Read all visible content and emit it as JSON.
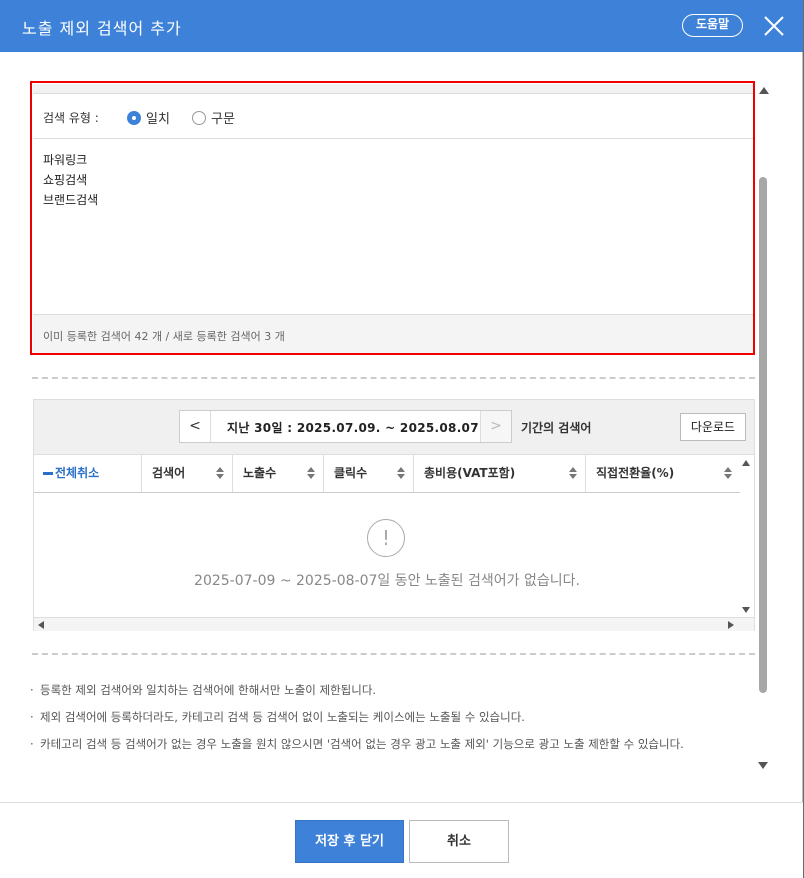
{
  "dialog": {
    "title": "노출 제외 검색어 추가",
    "help_label": "도움말"
  },
  "search_type": {
    "label": "검색 유형 :",
    "options": [
      {
        "label": "일치",
        "selected": true
      },
      {
        "label": "구문",
        "selected": false
      }
    ]
  },
  "keywords": [
    "파워링크",
    "쇼핑검색",
    "브랜드검색"
  ],
  "count_text": "이미 등록한 검색어 42 개 / 새로 등록한 검색어 3 개",
  "grid": {
    "prev_label": "<",
    "next_label": ">",
    "date_range": "지난 30일 : 2025.07.09. ~ 2025.08.07.",
    "period_label": "기간의 검색어",
    "download_label": "다운로드",
    "columns": [
      {
        "label": "전체취소"
      },
      {
        "label": "검색어"
      },
      {
        "label": "노출수"
      },
      {
        "label": "클릭수"
      },
      {
        "label": "총비용(VAT포함)"
      },
      {
        "label": "직접전환율(%)"
      }
    ],
    "empty_icon": "!",
    "empty_text": "2025-07-09 ~ 2025-08-07일 동안 노출된 검색어가 없습니다."
  },
  "notes": [
    "등록한 제외 검색어와 일치하는 검색어에 한해서만 노출이 제한됩니다.",
    "제외 검색어에 등록하더라도, 카테고리 검색 등 검색어 없이 노출되는 케이스에는 노출될 수 있습니다.",
    "카테고리 검색 등 검색어가 없는 경우 노출을 원치 않으시면 '검색어 없는 경우 광고 노출 제외' 기능으로 광고 노출 제한할 수 있습니다."
  ],
  "footer": {
    "save_label": "저장 후 닫기",
    "cancel_label": "취소"
  },
  "colors": {
    "header": "#3d82d8",
    "highlight": "#e00000",
    "primary_button": "#3d82d8"
  }
}
